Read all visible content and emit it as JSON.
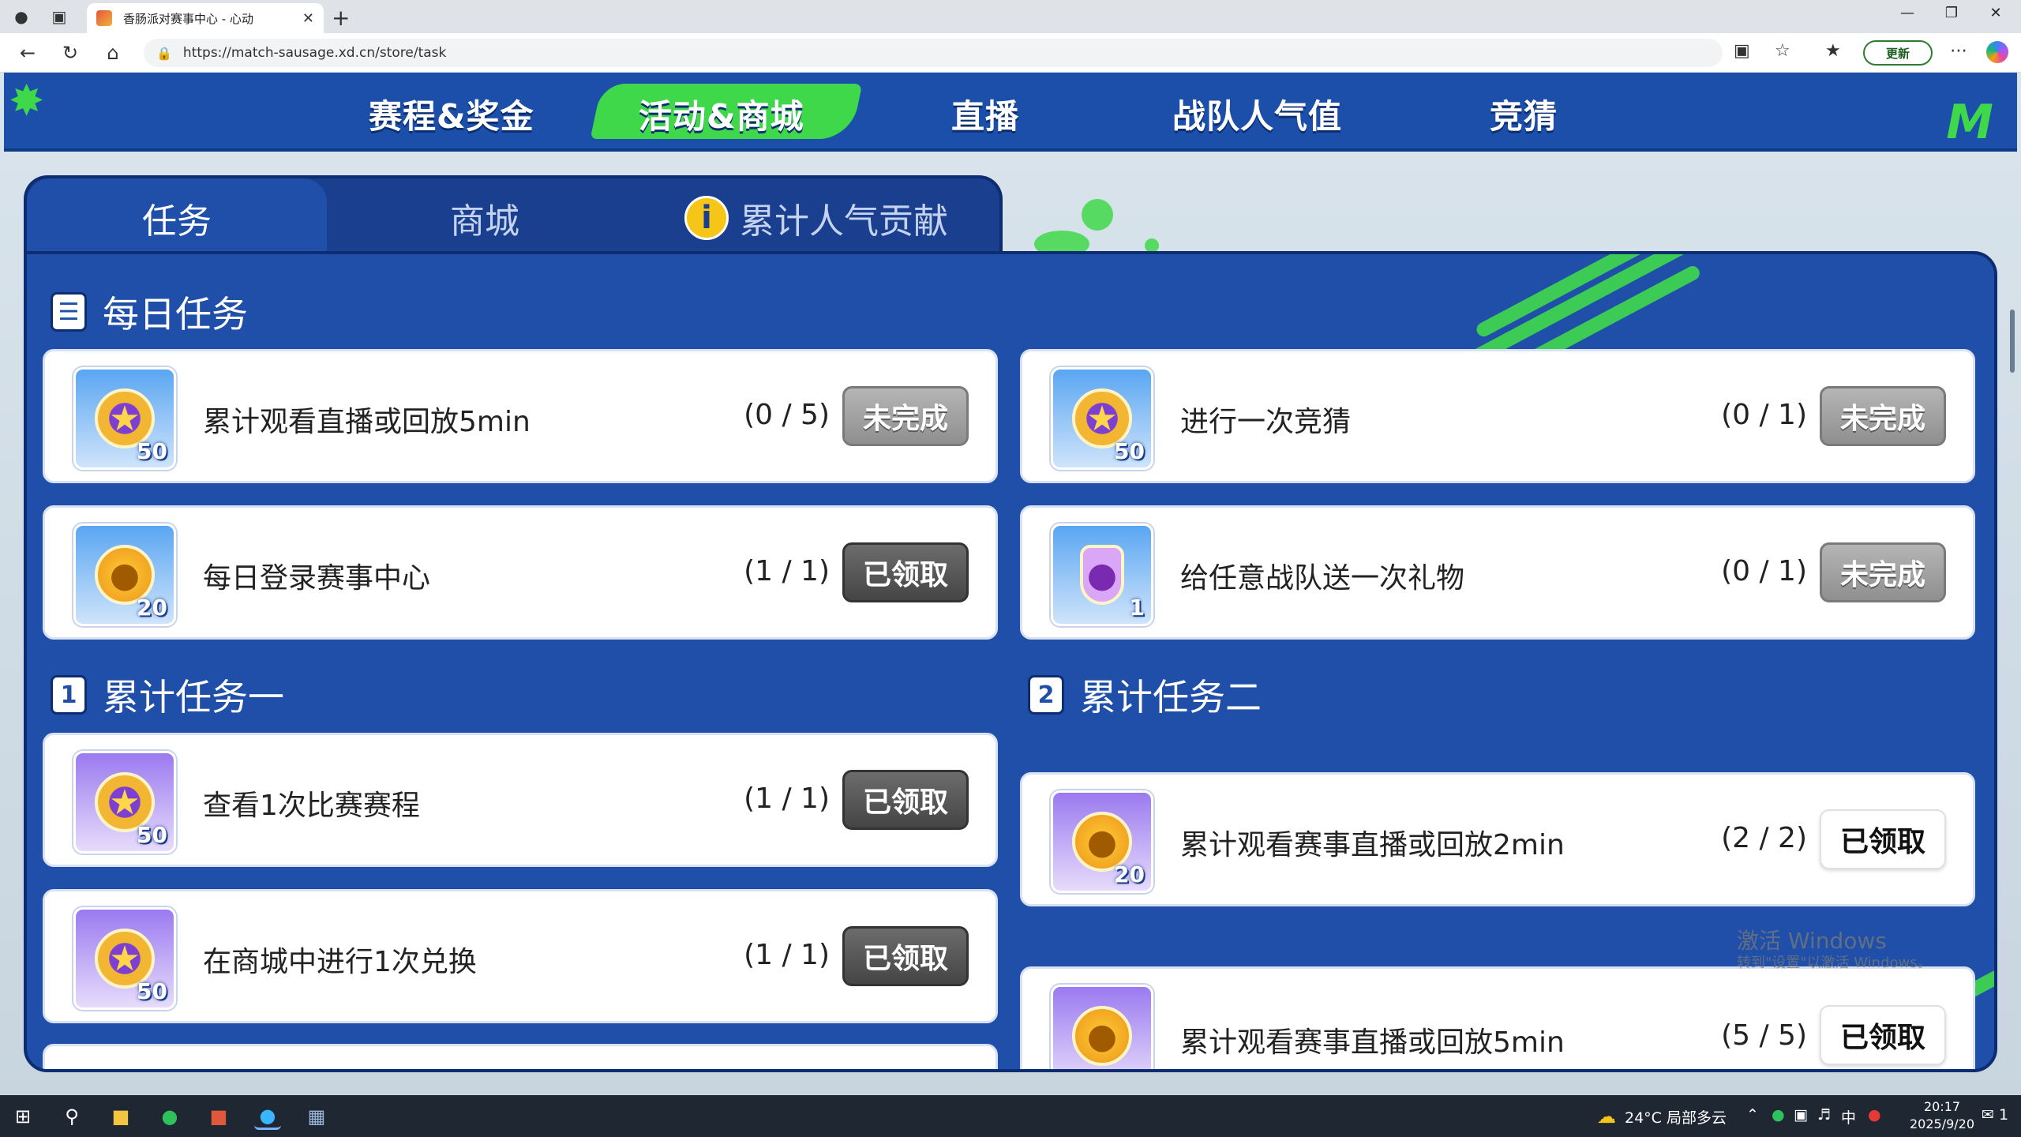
{
  "browser": {
    "tab_title": "香肠派对赛事中心 - 心动",
    "url": "https://match-sausage.xd.cn/store/task",
    "update_label": "更新"
  },
  "site": {
    "nav": [
      "赛程&奖金",
      "活动&商城",
      "直播",
      "战队人气值",
      "竞猜"
    ],
    "active_nav_index": 1,
    "panel_tabs": [
      "任务",
      "商城",
      "累计人气贡献"
    ],
    "active_panel_tab_index": 0
  },
  "sections": {
    "daily": {
      "title": "每日任务",
      "icon_label": ""
    },
    "cumulative1": {
      "title": "累计任务一",
      "icon_label": "1"
    },
    "cumulative2": {
      "title": "累计任务二",
      "icon_label": "2"
    }
  },
  "tasks": {
    "daily": [
      {
        "reward_qty": "50",
        "text": "累计观看直播或回放5min",
        "progress": "(0 / 5)",
        "status": "未完成"
      },
      {
        "reward_qty": "50",
        "text": "进行一次竞猜",
        "progress": "(0 / 1)",
        "status": "未完成"
      },
      {
        "reward_qty": "20",
        "text": "每日登录赛事中心",
        "progress": "(1 / 1)",
        "status": "已领取"
      },
      {
        "reward_qty": "1",
        "text": "给任意战队送一次礼物",
        "progress": "(0 / 1)",
        "status": "未完成"
      }
    ],
    "cumulative1": [
      {
        "reward_qty": "50",
        "text": "查看1次比赛赛程",
        "progress": "(1 / 1)",
        "status": "已领取"
      },
      {
        "reward_qty": "50",
        "text": "在商城中进行1次兑换",
        "progress": "(1 / 1)",
        "status": "已领取"
      }
    ],
    "cumulative2": [
      {
        "reward_qty": "20",
        "text": "累计观看赛事直播或回放2min",
        "progress": "(2 / 2)",
        "status": "已领取"
      },
      {
        "reward_qty": "",
        "text": "累计观看赛事直播或回放5min",
        "progress": "(5 / 5)",
        "status": "已领取"
      }
    ]
  },
  "watermark": {
    "line1": "激活 Windows",
    "line2": "转到\"设置\"以激活 Windows。"
  },
  "taskbar": {
    "weather": "24°C 局部多云",
    "ime": "中",
    "time": "20:17",
    "date": "2025/9/20",
    "notifications": "1"
  },
  "colors": {
    "brand_blue": "#1f4fa8",
    "accent_green": "#3fd84a"
  }
}
